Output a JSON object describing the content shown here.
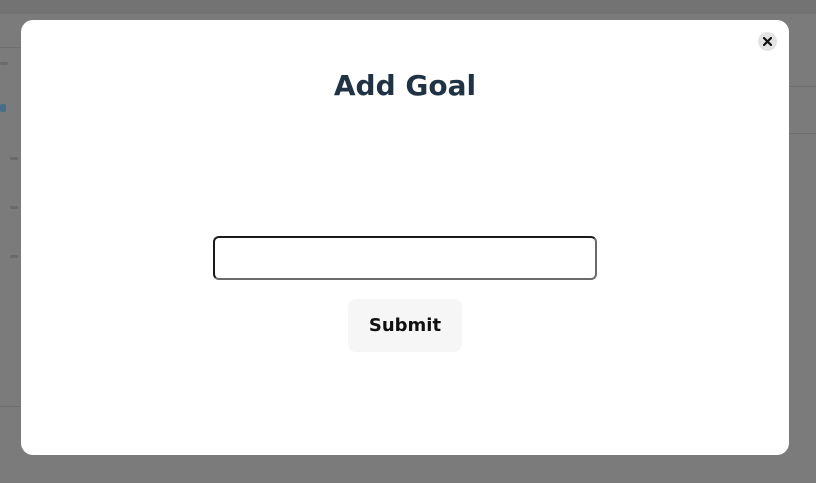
{
  "modal": {
    "title": "Add Goal",
    "input": {
      "value": "",
      "placeholder": ""
    },
    "submit_label": "Submit",
    "close_icon": "close-icon"
  },
  "colors": {
    "overlay": "#7a7a7a",
    "modal_bg": "#ffffff",
    "title": "#1f3344",
    "submit_bg": "#f6f6f6",
    "close_bg": "#e3e3e3"
  }
}
